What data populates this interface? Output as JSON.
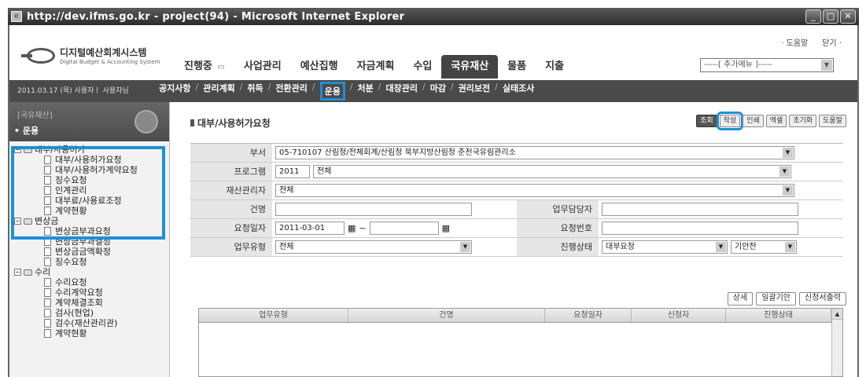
{
  "window": {
    "title": "http://dev.ifms.go.kr - project(94) - Microsoft Internet Explorer"
  },
  "logo": {
    "name": "디지털예산회계시스템",
    "sub": "Digital Budget & Accounting System"
  },
  "toplinks": [
    "· 도움말",
    "닫기 ·"
  ],
  "mainnav": [
    {
      "label": "진행중",
      "extra": "▭"
    },
    {
      "label": "사업관리"
    },
    {
      "label": "예산집행"
    },
    {
      "label": "자금계획"
    },
    {
      "label": "수입"
    },
    {
      "label": "국유재산",
      "active": true
    },
    {
      "label": "물품"
    },
    {
      "label": "지출"
    }
  ],
  "addmenu": "-----[ 추가메뉴 ]-----",
  "subbar": {
    "userinfo": "2011.03.17 (목) 사용자ㅣ 사용자님",
    "links": [
      "공지사항",
      "관리계획",
      "취득",
      "전환관리",
      "운용",
      "처분",
      "대장관리",
      "마감",
      "권리보전",
      "실태조사"
    ]
  },
  "sidebar": {
    "category": "[국유재산]",
    "current": "• 운용",
    "tree": [
      {
        "type": "folder",
        "label": "대부/사용허가"
      },
      {
        "type": "leaf",
        "label": "대부/사용허가요청"
      },
      {
        "type": "leaf",
        "label": "대부/사용허가계약요청"
      },
      {
        "type": "leaf",
        "label": "징수요청"
      },
      {
        "type": "leaf",
        "label": "인계관리"
      },
      {
        "type": "leaf",
        "label": "대부료/사용료조정"
      },
      {
        "type": "leaf",
        "label": "계약현황"
      },
      {
        "type": "folder",
        "label": "변상금"
      },
      {
        "type": "leaf",
        "label": "변상금부과요청"
      },
      {
        "type": "leaf",
        "label": "변상금부과결정"
      },
      {
        "type": "leaf",
        "label": "변상금금액확정"
      },
      {
        "type": "leaf",
        "label": "징수요청"
      },
      {
        "type": "folder",
        "label": "수리"
      },
      {
        "type": "leaf",
        "label": "수리요청"
      },
      {
        "type": "leaf",
        "label": "수리계약요청"
      },
      {
        "type": "leaf",
        "label": "계약체결조회"
      },
      {
        "type": "leaf",
        "label": "검사(현업)"
      },
      {
        "type": "leaf",
        "label": "검수(재산관리관)"
      },
      {
        "type": "leaf",
        "label": "계약현황"
      }
    ]
  },
  "page": {
    "title": "대부/사용허가요청",
    "actions": [
      "조회",
      "작성",
      "인쇄",
      "엑셀",
      "초기화",
      "도움말"
    ]
  },
  "form": {
    "dept_label": "부서",
    "dept_value": "05-710107 산림청/전체회계/산림청 북부지방산림청 춘천국유림관리소",
    "program_label": "프로그램",
    "program_year": "2011",
    "program_value": "전체",
    "manager_label": "재산관리자",
    "manager_value": "전체",
    "subject_label": "건명",
    "staff_label": "업무담당자",
    "date_label": "요청일자",
    "date_from": "2011-03-01",
    "date_sep": "~",
    "reqno_label": "요청번호",
    "worktype_label": "업무유형",
    "worktype_value": "전체",
    "status_label": "진행상태",
    "status_value": "대부요청",
    "status_sub": "기안전"
  },
  "grid": {
    "buttons": [
      "상세",
      "일괄기안",
      "신청서출력"
    ],
    "columns": [
      "업무유형",
      "건명",
      "요청일자",
      "신청자",
      "진행상태"
    ]
  }
}
